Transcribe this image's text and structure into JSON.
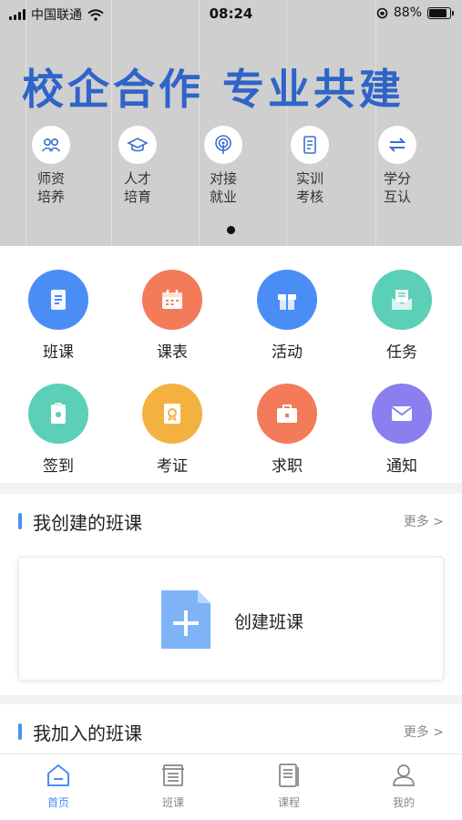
{
  "status_bar": {
    "carrier": "中国联通",
    "time": "08:24",
    "battery": "88%"
  },
  "banner": {
    "slogan": "校企合作  专业共建",
    "features": [
      {
        "icon": "people-icon",
        "line1": "师资",
        "line2": "培养"
      },
      {
        "icon": "graduation-cap-icon",
        "line1": "人才",
        "line2": "培育"
      },
      {
        "icon": "broadcast-icon",
        "line1": "对接",
        "line2": "就业"
      },
      {
        "icon": "document-icon",
        "line1": "实训",
        "line2": "考核"
      },
      {
        "icon": "exchange-arrows-icon",
        "line1": "学分",
        "line2": "互认"
      }
    ]
  },
  "grid": [
    {
      "label": "班课",
      "icon": "class-doc-icon",
      "color": "#4a8ef5"
    },
    {
      "label": "课表",
      "icon": "calendar-icon",
      "color": "#f37b5a"
    },
    {
      "label": "活动",
      "icon": "gift-icon",
      "color": "#4a8ef5"
    },
    {
      "label": "任务",
      "icon": "mail-open-icon",
      "color": "#5bcfb8"
    },
    {
      "label": "签到",
      "icon": "clipboard-check-icon",
      "color": "#5bcfb8"
    },
    {
      "label": "考证",
      "icon": "certificate-icon",
      "color": "#f3b13f"
    },
    {
      "label": "求职",
      "icon": "briefcase-icon",
      "color": "#f37b5a"
    },
    {
      "label": "通知",
      "icon": "envelope-icon",
      "color": "#8b7ff0"
    }
  ],
  "created_section": {
    "title": "我创建的班课",
    "more": "更多 >",
    "create_label": "创建班课"
  },
  "joined_section": {
    "title": "我加入的班课",
    "more": "更多 >"
  },
  "tabbar": [
    {
      "label": "首页",
      "icon": "home-icon",
      "active": true
    },
    {
      "label": "班课",
      "icon": "class-list-icon",
      "active": false
    },
    {
      "label": "课程",
      "icon": "course-book-icon",
      "active": false
    },
    {
      "label": "我的",
      "icon": "profile-icon",
      "active": false
    }
  ],
  "colors": {
    "accent": "#4a8ef5",
    "slogan": "#2f64c8"
  }
}
